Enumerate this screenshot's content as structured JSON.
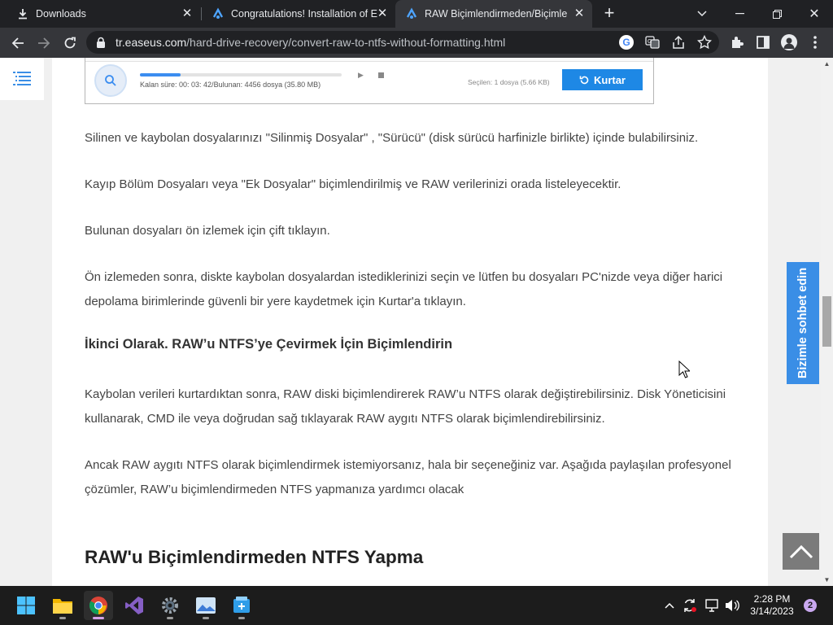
{
  "tabs": [
    {
      "title": "Downloads",
      "icon": "download-icon"
    },
    {
      "title": "Congratulations! Installation of Ea",
      "icon": "easeus-icon"
    },
    {
      "title": "RAW Biçimlendirmeden/Biçimlen",
      "icon": "easeus-icon",
      "active": true
    }
  ],
  "address_bar": {
    "host": "tr.easeus.com",
    "path": "/hard-drive-recovery/convert-raw-to-ntfs-without-formatting.html"
  },
  "embedded_screenshot": {
    "status": "Kalan süre: 00: 03: 42/Bulunan: 4456 dosya (35.80 MB)",
    "progress": 0.2,
    "selected": "Seçilen: 1 dosya (5.66 KB)",
    "recover_label": "Kurtar"
  },
  "article": {
    "p1": "Silinen ve kaybolan dosyalarınızı \"Silinmiş Dosyalar\" , \"Sürücü\" (disk sürücü harfinizle birlikte) içinde bulabilirsiniz.",
    "p2": "Kayıp Bölüm Dosyaları veya \"Ek Dosyalar\" biçimlendirilmiş ve RAW verilerinizi orada listeleyecektir.",
    "p3": "Bulunan dosyaları ön izlemek için çift tıklayın.",
    "p4": "Ön izlemeden sonra, diskte kaybolan dosyalardan istediklerinizi seçin ve lütfen bu dosyaları PC'nizde veya diğer harici depolama birimlerinde güvenli bir yere kaydetmek için Kurtar'a tıklayın.",
    "h3": "İkinci Olarak. RAW’u NTFS’ye Çevirmek İçin Biçimlendirin",
    "p5": "Kaybolan verileri kurtardıktan sonra, RAW diski biçimlendirerek RAW’u NTFS olarak değiştirebilirsiniz. Disk Yöneticisini kullanarak, CMD ile veya doğrudan sağ tıklayarak RAW aygıtı NTFS olarak biçimlendirebilirsiniz.",
    "p6": "Ancak RAW aygıtı NTFS olarak biçimlendirmek istemiyorsanız, hala bir seçeneğiniz var. Aşağıda paylaşılan profesyonel çözümler, RAW’u biçimlendirmeden NTFS yapmanıza yardımcı olacak",
    "h2": "RAW'u Biçimlendirmeden NTFS Yapma"
  },
  "chat_tab_label": "Bizimle sohbet edin",
  "taskbar": {
    "time": "2:28 PM",
    "date": "3/14/2023",
    "notification_count": "2"
  },
  "colors": {
    "accent_blue": "#3a8ee6",
    "recover_button": "#1e88e5",
    "tab_strip": "#202124",
    "toolbar": "#35363a"
  }
}
